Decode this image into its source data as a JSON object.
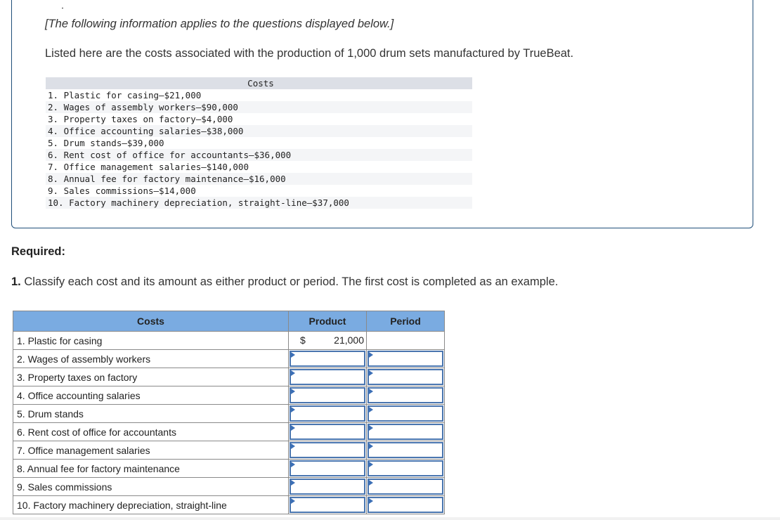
{
  "intro": {
    "note": "[The following information applies to the questions displayed below.]",
    "text": "Listed here are the costs associated with the production of 1,000 drum sets manufactured by TrueBeat."
  },
  "cost_list": {
    "header": "Costs",
    "items": [
      "1. Plastic for casing–$21,000",
      "2. Wages of assembly workers–$90,000",
      "3. Property taxes on factory–$4,000",
      "4. Office accounting salaries–$38,000",
      "5. Drum stands–$39,000",
      "6. Rent cost of office for accountants–$36,000",
      "7. Office management salaries–$140,000",
      "8. Annual fee for factory maintenance–$16,000",
      "9. Sales commissions–$14,000",
      "10. Factory machinery depreciation, straight-line–$37,000"
    ]
  },
  "required": {
    "title": "Required:",
    "question_number": "1.",
    "question_text": " Classify each cost and its amount as either product or period. The first cost is completed as an example."
  },
  "answer_table": {
    "headers": {
      "costs": "Costs",
      "product": "Product",
      "period": "Period"
    },
    "example": {
      "currency": "$",
      "product_value": "21,000"
    },
    "rows": [
      {
        "label": "1. Plastic for casing",
        "product": "",
        "period": ""
      },
      {
        "label": "2. Wages of assembly workers",
        "product": "",
        "period": ""
      },
      {
        "label": "3. Property taxes on factory",
        "product": "",
        "period": ""
      },
      {
        "label": "4. Office accounting salaries",
        "product": "",
        "period": ""
      },
      {
        "label": "5. Drum stands",
        "product": "",
        "period": ""
      },
      {
        "label": "6. Rent cost of office for accountants",
        "product": "",
        "period": ""
      },
      {
        "label": "7. Office management salaries",
        "product": "",
        "period": ""
      },
      {
        "label": "8. Annual fee for factory maintenance",
        "product": "",
        "period": ""
      },
      {
        "label": "9. Sales commissions",
        "product": "",
        "period": ""
      },
      {
        "label": "10. Factory machinery depreciation, straight-line",
        "product": "",
        "period": ""
      }
    ]
  },
  "colors": {
    "header_bg": "#7aabe1",
    "input_border": "#4a76b0",
    "box_border": "#1f4e79"
  }
}
